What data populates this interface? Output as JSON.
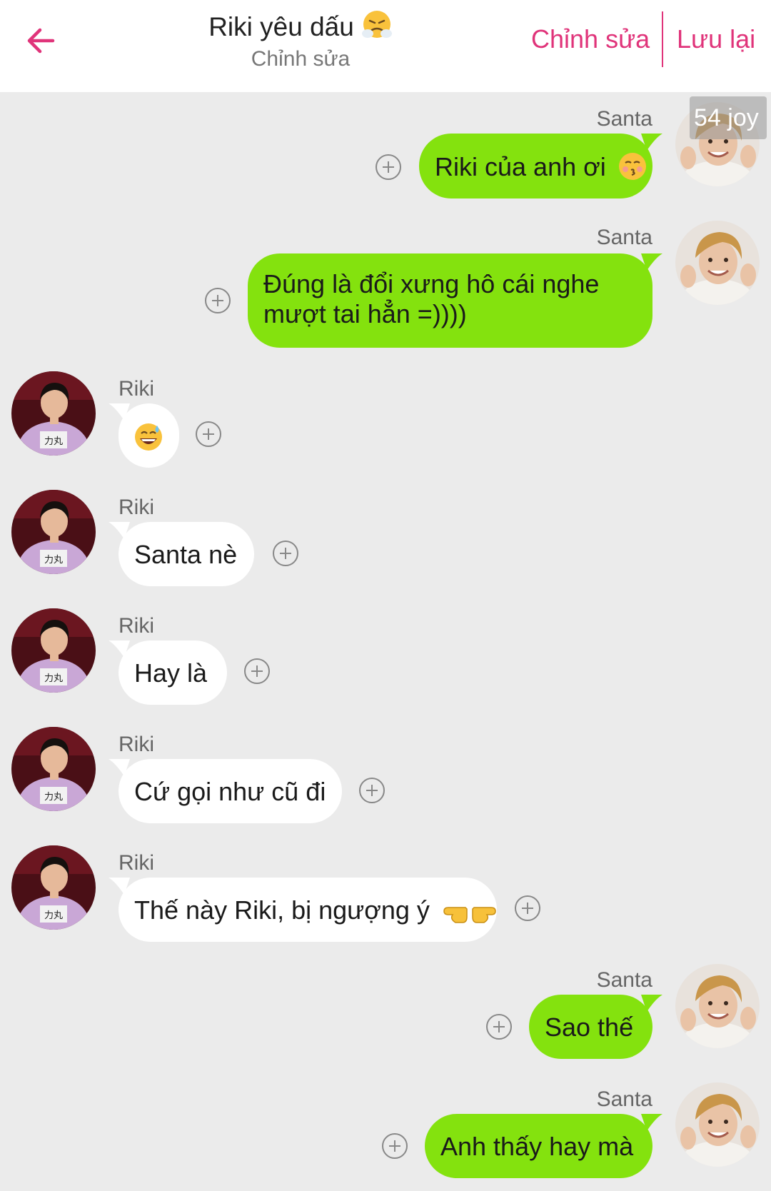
{
  "header": {
    "title": "Riki yêu dấu",
    "title_emoji": "steaming-face-emoji",
    "subtitle": "Chỉnh sửa",
    "edit_label": "Chỉnh sửa",
    "save_label": "Lưu lại",
    "accent_color": "#e0347a"
  },
  "overlay_badge": "54 joy",
  "colors": {
    "sent_bubble": "#84e20e",
    "received_bubble": "#ffffff",
    "background": "#ebebeb"
  },
  "messages": [
    {
      "sender": "Santa",
      "side": "right",
      "text": "Riki của anh ơi",
      "emoji": "kissing-face-emoji"
    },
    {
      "sender": "Santa",
      "side": "right",
      "lines": [
        "Đúng là đổi xưng hô cái nghe",
        "mượt tai hẳn =))))"
      ]
    },
    {
      "sender": "Riki",
      "side": "left",
      "emoji": "grinning-sweat-emoji"
    },
    {
      "sender": "Riki",
      "side": "left",
      "text": "Santa nè"
    },
    {
      "sender": "Riki",
      "side": "left",
      "text": "Hay là"
    },
    {
      "sender": "Riki",
      "side": "left",
      "text": "Cứ gọi như cũ đi"
    },
    {
      "sender": "Riki",
      "side": "left",
      "text": "Thế này Riki, bị ngượng ý",
      "emoji": "pointing-fingers-emoji"
    },
    {
      "sender": "Santa",
      "side": "right",
      "text": "Sao thế"
    },
    {
      "sender": "Santa",
      "side": "right",
      "text": "Anh thấy hay mà"
    }
  ]
}
